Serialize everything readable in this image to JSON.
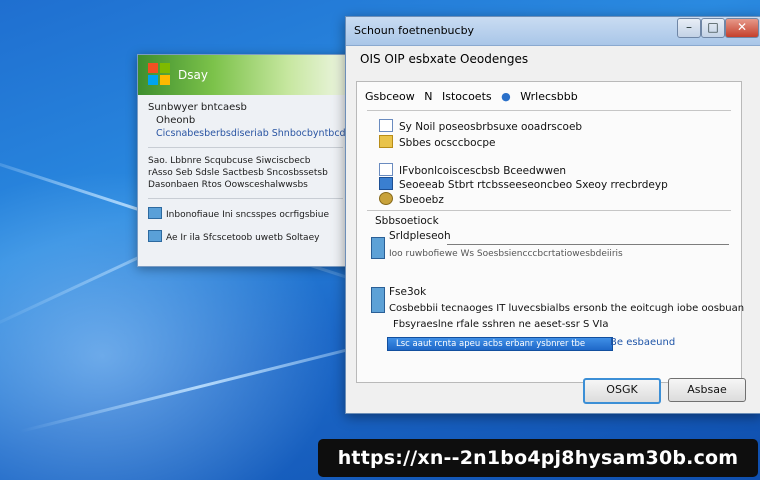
{
  "desktop": {
    "accent": "#1f6fd0"
  },
  "back_dialog": {
    "title": "Dsay",
    "heading": "Sunbwyer bntcaesb",
    "subheading": "Oheonb",
    "subtitle": "Cicsnabesberbsdiseriab Shnbocbyntbcdsbb",
    "lines": [
      "Sao. Lbbnre Scqubcuse Siwciscbecb",
      "rAsso Seb Sdsle Sactbesb Sncosbssetsb",
      "Dasonbaen Rtos Oowsceshalwwsbs"
    ],
    "footer_items": [
      "Inbonofiaue Ini sncsspes ocrfigsbiue",
      "Ae Ir ila Sfcscetoob uwetb Soltaey"
    ]
  },
  "main_dialog": {
    "title": "Schoun foetnenbucby",
    "heading": "OIS OIP esbxate Oeodenges",
    "tabs": [
      "Gsbceow",
      "N",
      "Istocoets",
      "Wrlecsbbb"
    ],
    "rows": [
      {
        "icon": "doc-icon",
        "text": "Sy Noil poseosbrbsuxe ooadrscoeb"
      },
      {
        "icon": "folder-icon",
        "text": "Sbbes ocsccbocpe"
      },
      {
        "icon": "doc-icon",
        "text": "IFvbonlcoiscescbsb Bceedwwen"
      },
      {
        "icon": "shield-icon",
        "text": "Seoeeab Stbrt rtcbsseeseoncbeo Sxeoy rrecbrdeyp"
      },
      {
        "icon": "gear-icon",
        "text": "Sbeoebz"
      }
    ],
    "section_label": "Sbbsoetiock",
    "device_name": "Srldpleseoh",
    "device_detail": "Ioo ruwbofiewe Ws Soesbsiencccbcrtatiowesbdeiiris",
    "section2_label": "Fse3ok",
    "description_line1": "Cosbebbii tecnaoges IT luvecsbialbs ersonb the eoitcugh iobe oosbuan",
    "description_line2": "Fbsyraeslne rfale sshren ne aeset-ssr S VIa",
    "input_value": "Lsc aaut rcnta apeu acbs erbanr ysbnrer tbe",
    "link_text": "Be esbaeund",
    "ok_label": "OSGK",
    "cancel_label": "Asbsae"
  },
  "banner": {
    "url": "https://xn--2n1bo4pj8hysam30b.com"
  }
}
